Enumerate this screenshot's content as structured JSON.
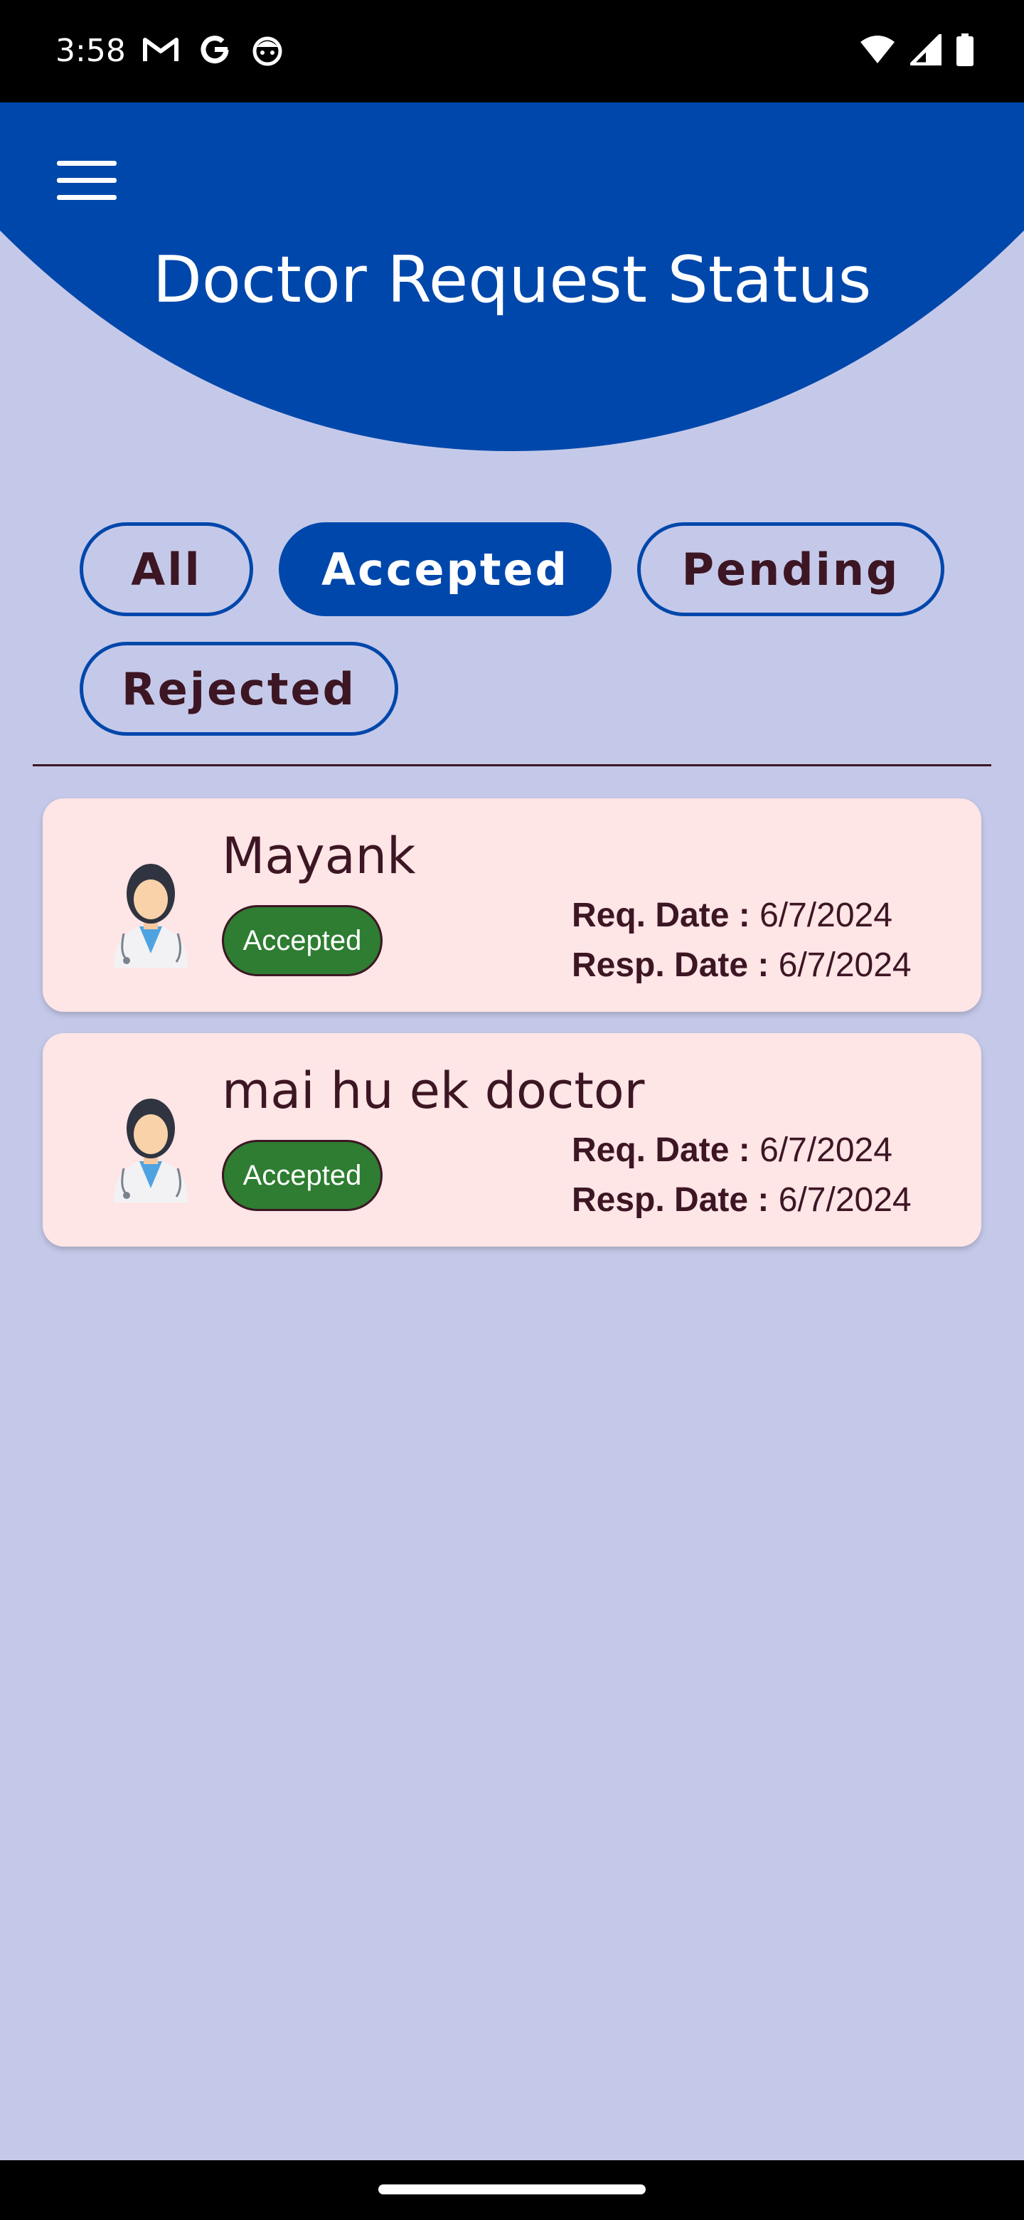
{
  "status_bar": {
    "time": "3:58",
    "left_icons": [
      "gmail-icon",
      "google-icon",
      "face-icon"
    ],
    "right_icons": [
      "wifi-icon",
      "signal-icon",
      "battery-icon"
    ]
  },
  "header": {
    "title": "Doctor Request Status",
    "menu_icon": "menu-icon",
    "color": "#0047ab"
  },
  "filters": [
    {
      "label": "All",
      "active": false
    },
    {
      "label": "Accepted",
      "active": true
    },
    {
      "label": "Pending",
      "active": false
    },
    {
      "label": "Rejected",
      "active": false
    }
  ],
  "requests": [
    {
      "name": "Mayank",
      "status": "Accepted",
      "req_date_label": "Req. Date :",
      "req_date": "6/7/2024",
      "resp_date_label": "Resp. Date :",
      "resp_date": "6/7/2024",
      "avatar_icon": "doctor-avatar-icon"
    },
    {
      "name": "mai hu ek doctor",
      "status": "Accepted",
      "req_date_label": "Req. Date :",
      "req_date": "6/7/2024",
      "resp_date_label": "Resp. Date :",
      "resp_date": "6/7/2024",
      "avatar_icon": "doctor-avatar-icon"
    }
  ],
  "colors": {
    "background": "#c5c9e9",
    "primary": "#0047ab",
    "card": "#fee5e6",
    "text": "#3d1624",
    "accepted_badge": "#2e7d32"
  }
}
